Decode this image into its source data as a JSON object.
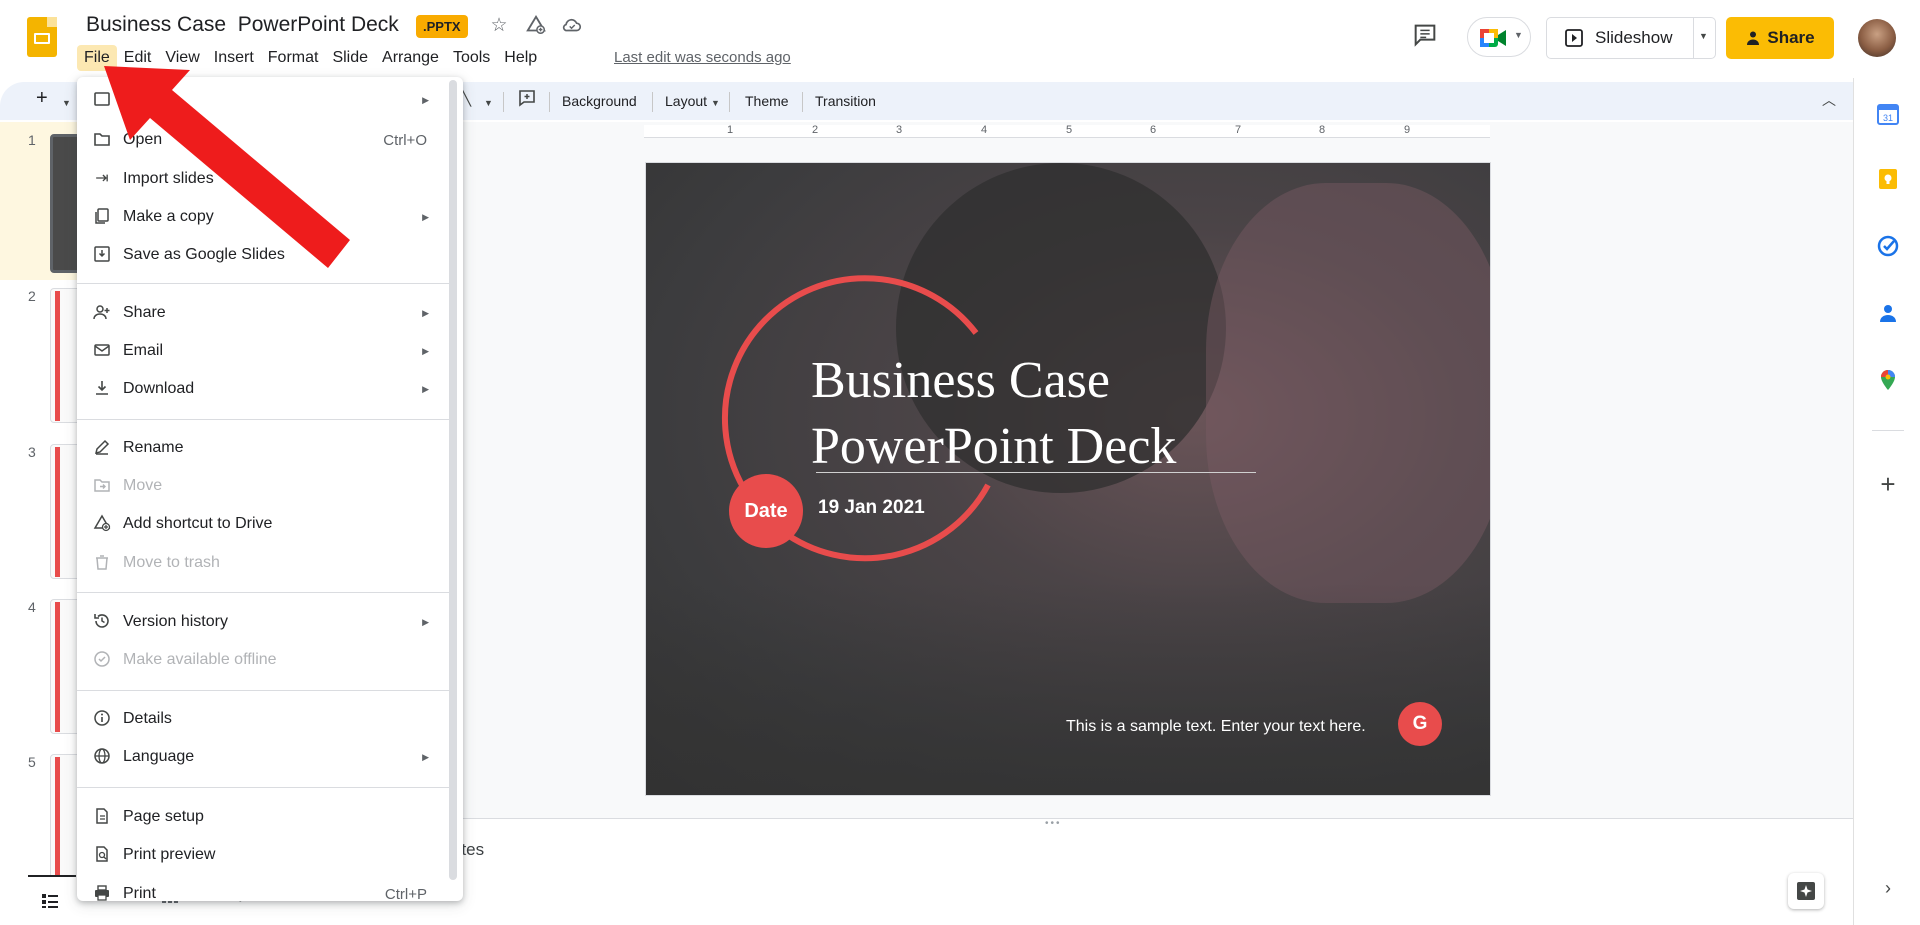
{
  "header": {
    "doc_title": "Business Case  PowerPoint Deck",
    "file_badge": ".PPTX",
    "last_edit": "Last edit was seconds ago",
    "slideshow_label": "Slideshow",
    "share_label": "Share"
  },
  "menubar": {
    "items": [
      "File",
      "Edit",
      "View",
      "Insert",
      "Format",
      "Slide",
      "Arrange",
      "Tools",
      "Help"
    ],
    "active": "File"
  },
  "toolbar": {
    "background": "Background",
    "layout": "Layout",
    "theme": "Theme",
    "transition": "Transition"
  },
  "ruler": [
    "1",
    "2",
    "3",
    "4",
    "5",
    "6",
    "7",
    "8",
    "9"
  ],
  "filmstrip": {
    "slide_numbers": [
      "1",
      "2",
      "3",
      "4",
      "5"
    ]
  },
  "slide": {
    "title_line1": "Business Case",
    "title_line2": "PowerPoint Deck",
    "date_badge": "Date",
    "date_text": "19 Jan 2021",
    "footer_text": "This is a sample text. Enter your text here.",
    "corner_badge": "G",
    "accent_color": "#e84c4c"
  },
  "notes": {
    "label": "otes"
  },
  "file_menu": {
    "items": [
      {
        "label": "",
        "icon": "new-icon",
        "submenu": true
      },
      {
        "label": "Open",
        "icon": "folder-icon",
        "shortcut": "Ctrl+O"
      },
      {
        "label": "Import slides",
        "icon": "import-icon"
      },
      {
        "label": "Make a copy",
        "icon": "copy-icon",
        "submenu": true
      },
      {
        "label": "Save as Google Slides",
        "icon": "save-icon"
      },
      {
        "label": "Share",
        "icon": "person-add-icon",
        "submenu": true
      },
      {
        "label": "Email",
        "icon": "email-icon",
        "submenu": true
      },
      {
        "label": "Download",
        "icon": "download-icon",
        "submenu": true
      },
      {
        "label": "Rename",
        "icon": "pencil-icon"
      },
      {
        "label": "Move",
        "icon": "move-icon",
        "disabled": true
      },
      {
        "label": "Add shortcut to Drive",
        "icon": "drive-shortcut-icon"
      },
      {
        "label": "Move to trash",
        "icon": "trash-icon",
        "disabled": true
      },
      {
        "label": "Version history",
        "icon": "history-icon",
        "submenu": true
      },
      {
        "label": "Make available offline",
        "icon": "offline-icon",
        "disabled": true
      },
      {
        "label": "Details",
        "icon": "info-icon"
      },
      {
        "label": "Language",
        "icon": "globe-icon",
        "submenu": true
      },
      {
        "label": "Page setup",
        "icon": "page-setup-icon"
      },
      {
        "label": "Print preview",
        "icon": "print-preview-icon"
      },
      {
        "label": "Print",
        "icon": "print-icon",
        "shortcut": "Ctrl+P"
      }
    ]
  },
  "colors": {
    "brand_yellow": "#fbbc04",
    "menu_active_bg": "#fce8b2",
    "annotation_arrow": "#ee1c1c"
  }
}
